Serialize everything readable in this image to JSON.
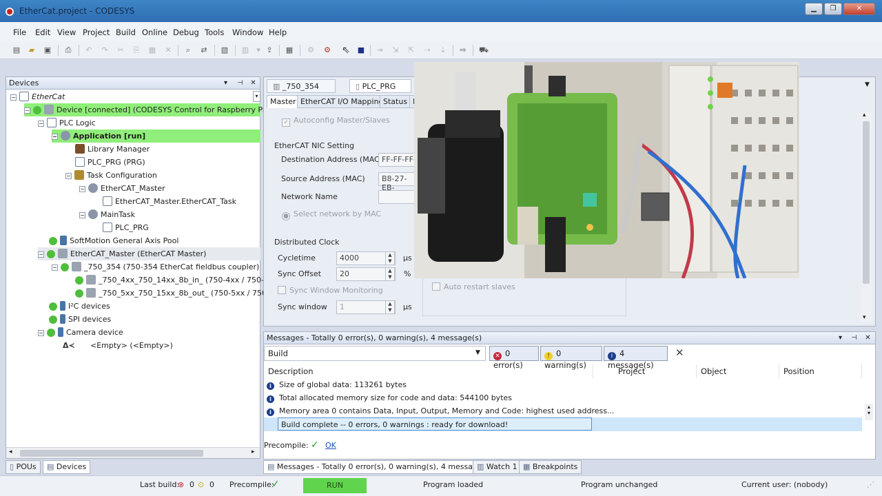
{
  "window": {
    "title": "EtherCat.project - CODESYS"
  },
  "menu": [
    "File",
    "Edit",
    "View",
    "Project",
    "Build",
    "Online",
    "Debug",
    "Tools",
    "Window",
    "Help"
  ],
  "devices_pane": {
    "title": "Devices",
    "tree": [
      {
        "label": "EtherCat",
        "style": "ital"
      },
      {
        "label": "Device [connected] (CODESYS Control for Raspberry Pi)",
        "style": "sel"
      },
      {
        "label": "PLC Logic",
        "style": ""
      },
      {
        "label": "Application [run]",
        "style": "sel bold"
      },
      {
        "label": "Library Manager",
        "style": ""
      },
      {
        "label": "PLC_PRG (PRG)",
        "style": ""
      },
      {
        "label": "Task Configuration",
        "style": ""
      },
      {
        "label": "EtherCAT_Master",
        "style": ""
      },
      {
        "label": "EtherCAT_Master.EtherCAT_Task",
        "style": ""
      },
      {
        "label": "MainTask",
        "style": ""
      },
      {
        "label": "PLC_PRG",
        "style": ""
      },
      {
        "label": "SoftMotion General Axis Pool",
        "style": ""
      },
      {
        "label": "EtherCAT_Master (EtherCAT Master)",
        "style": "hl"
      },
      {
        "label": "_750_354 (750-354 EtherCat fieldbus coupler)",
        "style": ""
      },
      {
        "label": "_750_4xx_750_14xx_8b_in_ (750-4xx / 750-14",
        "style": ""
      },
      {
        "label": "_750_5xx_750_15xx_8b_out_ (750-5xx / 750-1",
        "style": ""
      },
      {
        "label": "I²C devices",
        "style": ""
      },
      {
        "label": "SPI devices",
        "style": ""
      },
      {
        "label": "Camera device",
        "style": ""
      },
      {
        "label": "<Empty> (<Empty>)",
        "style": ""
      }
    ]
  },
  "editor": {
    "doc_tabs": [
      "_750_354",
      "PLC_PRG"
    ],
    "sub_tabs": [
      "Master",
      "EtherCAT I/O Mapping",
      "Status",
      "I"
    ],
    "autoconfig": "Autoconfig Master/Slaves",
    "nic_group": "EtherCAT NIC Setting",
    "dest_label": "Destination Address (MAC)",
    "dest_value": "FF-FF-FF-",
    "src_label": "Source Address (MAC)",
    "src_value": "B8-27-EB-",
    "netname_label": "Network Name",
    "select_by_mac": "Select network by MAC",
    "dc_group": "Distributed Clock",
    "cycletime_label": "Cycletime",
    "cycletime_value": "4000",
    "cycletime_unit": "µs",
    "syncoffset_label": "Sync Offset",
    "syncoffset_value": "20",
    "syncoffset_unit": "%",
    "syncwin_mon": "Sync Window Monitoring",
    "syncwin_label": "Sync window",
    "syncwin_value": "1",
    "syncwin_unit": "µs",
    "auto_restart": "Auto restart slaves"
  },
  "messages": {
    "title": "Messages - Totally 0 error(s), 0 warning(s), 4 message(s)",
    "filter": "Build",
    "errors": "0 error(s)",
    "warnings": "0 warning(s)",
    "msgs": "4 message(s)",
    "columns": [
      "Description",
      "Project",
      "Object",
      "Position"
    ],
    "rows": [
      "Size of global data: 113261 bytes",
      "Total allocated memory size for code and data: 544100 bytes",
      "Memory area 0 contains  Data, Input, Output, Memory and Code: highest used address...",
      "Build complete -- 0 errors, 0 warnings : ready for download!"
    ],
    "precompile_label": "Precompile:",
    "precompile_status": "OK"
  },
  "left_tabs": [
    "POUs",
    "Devices"
  ],
  "bottom_tabs": [
    "Messages - Totally 0 error(s), 0 warning(s), 4 message(s)",
    "Watch 1",
    "Breakpoints"
  ],
  "status": {
    "last_build": "Last build:",
    "err_count": "0",
    "warn_count": "0",
    "precompile": "Precompile:",
    "run": "RUN",
    "program_loaded": "Program loaded",
    "program_unchanged": "Program unchanged",
    "current_user": "Current user: (nobody)"
  }
}
